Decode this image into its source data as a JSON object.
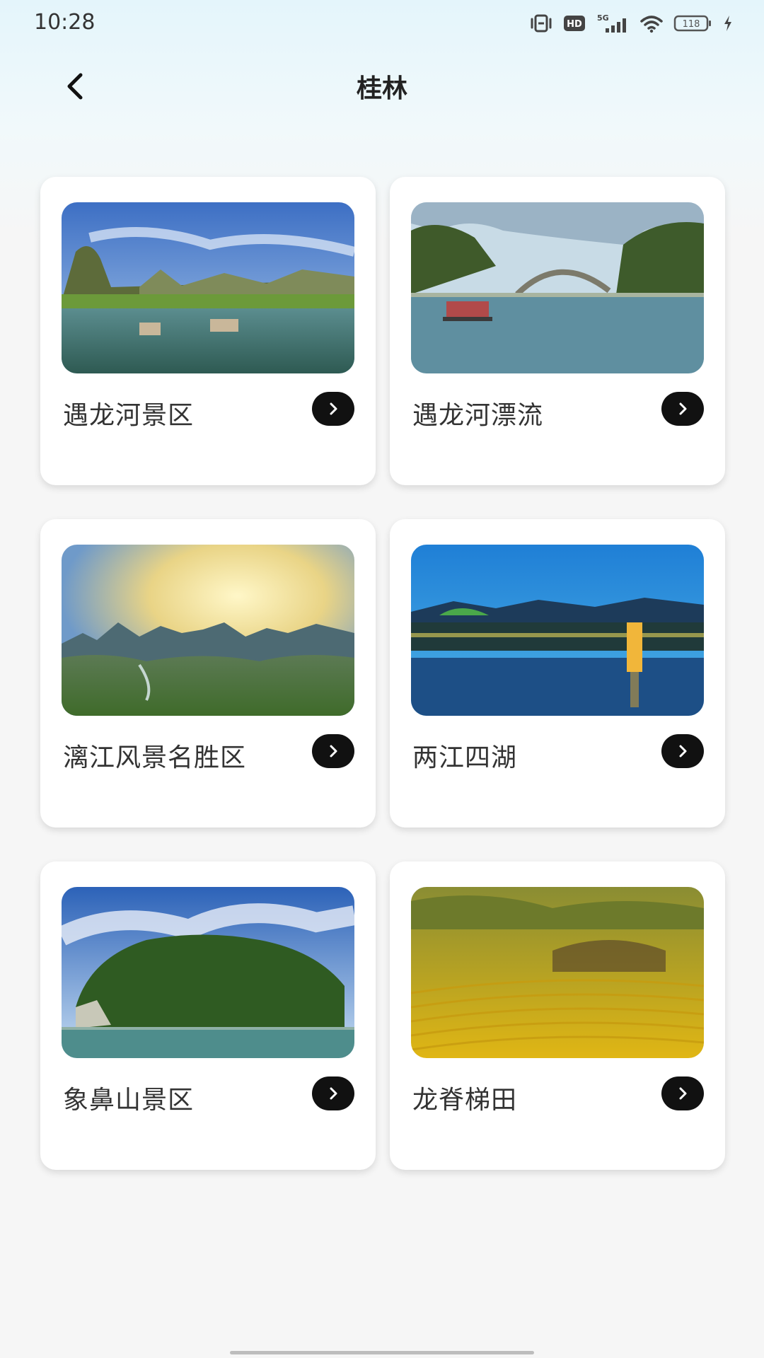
{
  "status_bar": {
    "time": "10:28",
    "network_label": "5G",
    "hd_label": "HD",
    "battery_level": "118"
  },
  "header": {
    "title": "桂林",
    "back_icon": "chevron-left-icon"
  },
  "cards": [
    {
      "title": "遇龙河景区",
      "arrow_icon": "chevron-right-icon"
    },
    {
      "title": "遇龙河漂流",
      "arrow_icon": "chevron-right-icon"
    },
    {
      "title": "漓江风景名胜区",
      "arrow_icon": "chevron-right-icon"
    },
    {
      "title": "两江四湖",
      "arrow_icon": "chevron-right-icon"
    },
    {
      "title": "象鼻山景区",
      "arrow_icon": "chevron-right-icon"
    },
    {
      "title": "龙脊梯田",
      "arrow_icon": "chevron-right-icon"
    }
  ]
}
